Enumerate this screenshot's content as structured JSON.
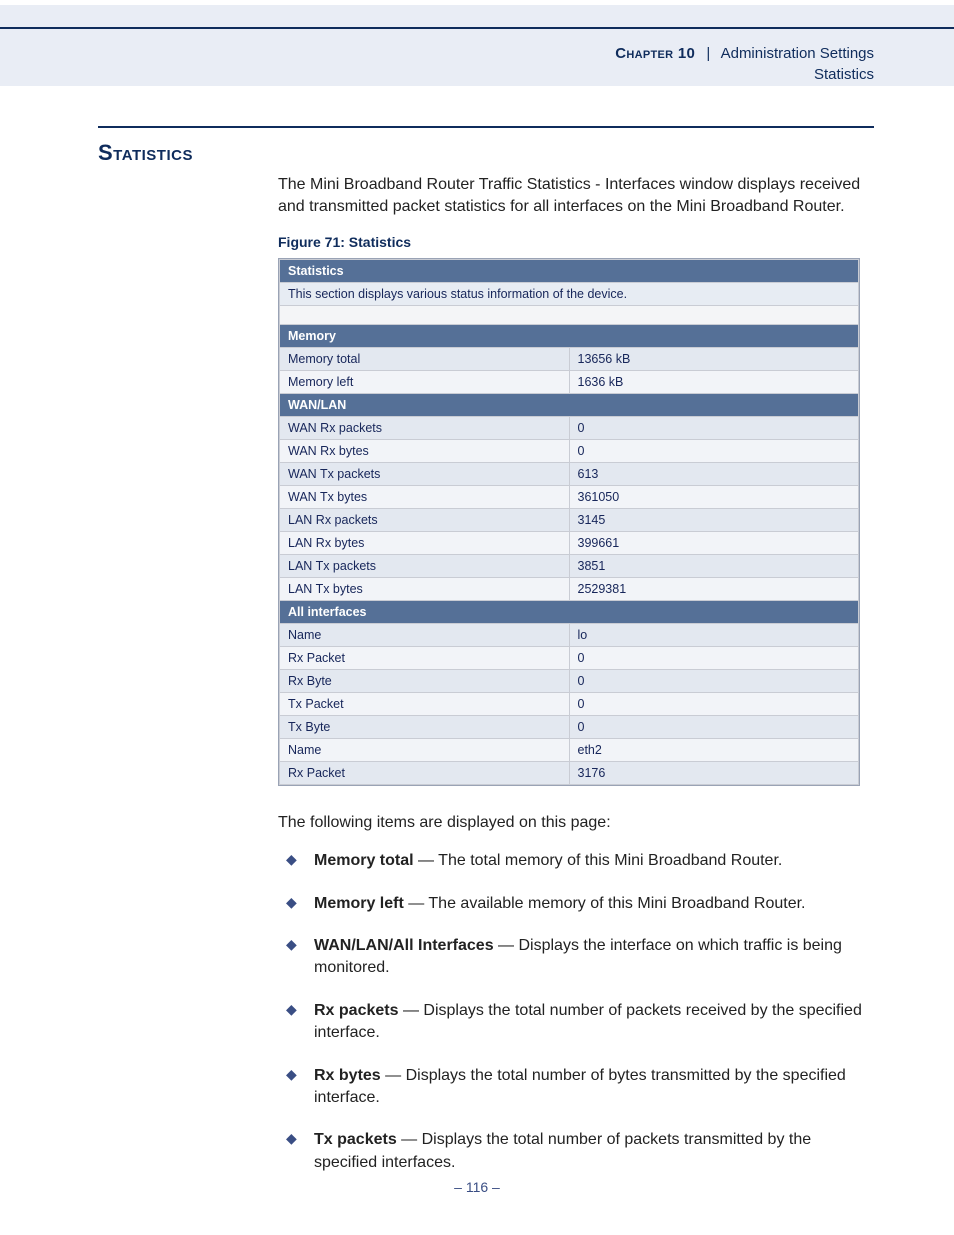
{
  "header": {
    "chapter_label": "Chapter 10",
    "separator": "|",
    "chapter_title": "Administration Settings",
    "sub_title": "Statistics"
  },
  "section": {
    "title": "Statistics",
    "intro": "The Mini Broadband Router Traffic Statistics - Interfaces window displays received and transmitted packet statistics for all interfaces on the Mini Broadband Router.",
    "figure_caption": "Figure 71:  Statistics",
    "items_intro": "The following items are displayed on this page:"
  },
  "router_ui": {
    "main_header": "Statistics",
    "note": "This section displays various status information of the device.",
    "groups": [
      {
        "title": "Memory",
        "rows": [
          {
            "label": "Memory total",
            "value": "13656 kB"
          },
          {
            "label": "Memory left",
            "value": "1636 kB"
          }
        ]
      },
      {
        "title": "WAN/LAN",
        "rows": [
          {
            "label": "WAN Rx packets",
            "value": "0"
          },
          {
            "label": "WAN Rx bytes",
            "value": "0"
          },
          {
            "label": "WAN Tx packets",
            "value": "613"
          },
          {
            "label": "WAN Tx bytes",
            "value": "361050"
          },
          {
            "label": "LAN Rx packets",
            "value": "3145"
          },
          {
            "label": "LAN Rx bytes",
            "value": "399661"
          },
          {
            "label": "LAN Tx packets",
            "value": "3851"
          },
          {
            "label": "LAN Tx bytes",
            "value": "2529381"
          }
        ]
      },
      {
        "title": "All interfaces",
        "rows": [
          {
            "label": "Name",
            "value": "lo"
          },
          {
            "label": "Rx Packet",
            "value": "0"
          },
          {
            "label": "Rx Byte",
            "value": "0"
          },
          {
            "label": "Tx Packet",
            "value": "0"
          },
          {
            "label": "Tx Byte",
            "value": "0"
          },
          {
            "label": "Name",
            "value": "eth2"
          },
          {
            "label": "Rx Packet",
            "value": "3176"
          }
        ]
      }
    ]
  },
  "bullets": [
    {
      "term": "Memory total",
      "desc": " — The total memory of this Mini Broadband Router."
    },
    {
      "term": "Memory left",
      "desc": " — The available memory of this Mini Broadband Router."
    },
    {
      "term": "WAN/LAN/All Interfaces",
      "desc": " — Displays the interface on which traffic is being monitored."
    },
    {
      "term": "Rx packets",
      "desc": " — Displays the total number of packets received by the specified interface."
    },
    {
      "term": "Rx bytes",
      "desc": " — Displays the total number of bytes transmitted by the specified interface."
    },
    {
      "term": "Tx packets",
      "desc": " — Displays the total number of packets transmitted by the specified interfaces."
    }
  ],
  "page_number": "–  116  –"
}
